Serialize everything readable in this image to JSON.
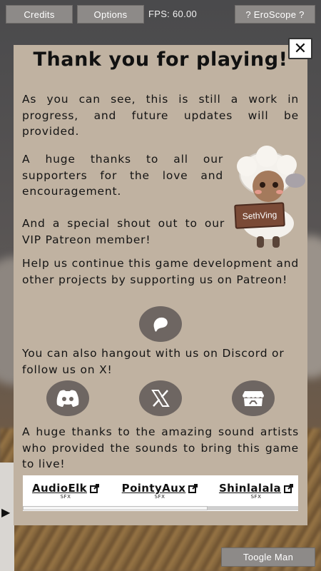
{
  "topbar": {
    "credits_label": "Credits",
    "options_label": "Options",
    "fps_text": "FPS: 60.00",
    "eroscope_label": "? EroScope ?"
  },
  "toggle_label": "Toogle Man",
  "dialog": {
    "close_glyph": "✕",
    "title": "Thank you for playing!",
    "para1": "As you can see, this is still a work in progress, and future updates will be provided.",
    "para2": "A huge thanks to all our supporters for the love and encouragement.",
    "para3": "And a special shout out to our VIP Patreon member!",
    "vip_name": "SethVing",
    "para4": "Help us continue this game development and other projects by supporting us on Patreon!",
    "para5": "You can also hangout with us on Discord or follow us on X!",
    "para6": "A huge thanks to the amazing sound artists who provided the sounds to bring this game to live!",
    "social_icons": [
      "patreon-icon",
      "discord-icon",
      "x-icon",
      "itch-icon"
    ],
    "artists": [
      {
        "name": "AudioElk",
        "tag": "SFX"
      },
      {
        "name": "PointyAux",
        "tag": "SFX"
      },
      {
        "name": "Shinlalala",
        "tag": "SFX"
      }
    ],
    "carousel_scroll_fraction": 0.67
  },
  "colors": {
    "panel": "#c0b2a1",
    "icon_circle": "#6e6662",
    "button": "#8d8a88"
  }
}
